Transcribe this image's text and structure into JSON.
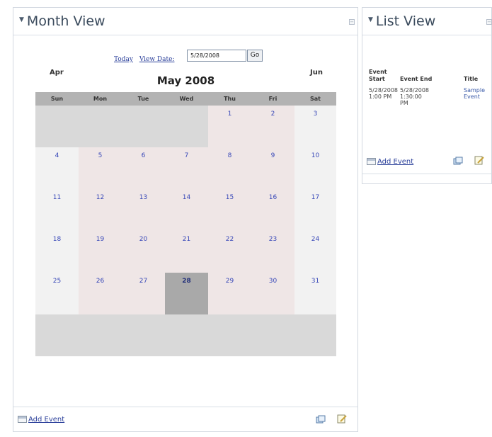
{
  "month_view": {
    "title": "Month View",
    "nav": {
      "today": "Today",
      "view_date": "View Date:",
      "date_value": "5/28/2008",
      "go": "Go"
    },
    "calendar": {
      "prev": "Apr",
      "next": "Jun",
      "title": "May 2008",
      "days_of_week": [
        "Sun",
        "Mon",
        "Tue",
        "Wed",
        "Thu",
        "Fri",
        "Sat"
      ],
      "weeks": [
        [
          "",
          "",
          "",
          "",
          "1",
          "2",
          "3"
        ],
        [
          "4",
          "5",
          "6",
          "7",
          "8",
          "9",
          "10"
        ],
        [
          "11",
          "12",
          "13",
          "14",
          "15",
          "16",
          "17"
        ],
        [
          "18",
          "19",
          "20",
          "21",
          "22",
          "23",
          "24"
        ],
        [
          "25",
          "26",
          "27",
          "28",
          "29",
          "30",
          "31"
        ],
        [
          "",
          "",
          "",
          "",
          "",
          "",
          ""
        ]
      ],
      "selected_day": "28"
    },
    "footer": {
      "add_event": "Add Event"
    }
  },
  "list_view": {
    "title": "List View",
    "columns": [
      "Event Start",
      "Event End",
      "Title"
    ],
    "rows": [
      {
        "start": "5/28/2008 1:00 PM",
        "end": "5/28/2008 1:30:00 PM",
        "title": "Sample Event"
      }
    ],
    "footer": {
      "add_event": "Add Event"
    }
  },
  "icons": [
    "triangle-down-icon",
    "minimize-icon",
    "add-event-icon",
    "refresh-icon",
    "edit-icon"
  ],
  "colors": {
    "weekday_cell": "#efe6e6",
    "weekend_cell": "#f2f2f2",
    "other_month_cell": "#d9d9d9",
    "selected_cell": "#a9a9a9",
    "header_row": "#b3b3b3",
    "link": "#2a3f9a",
    "day_number": "#3848b8"
  }
}
